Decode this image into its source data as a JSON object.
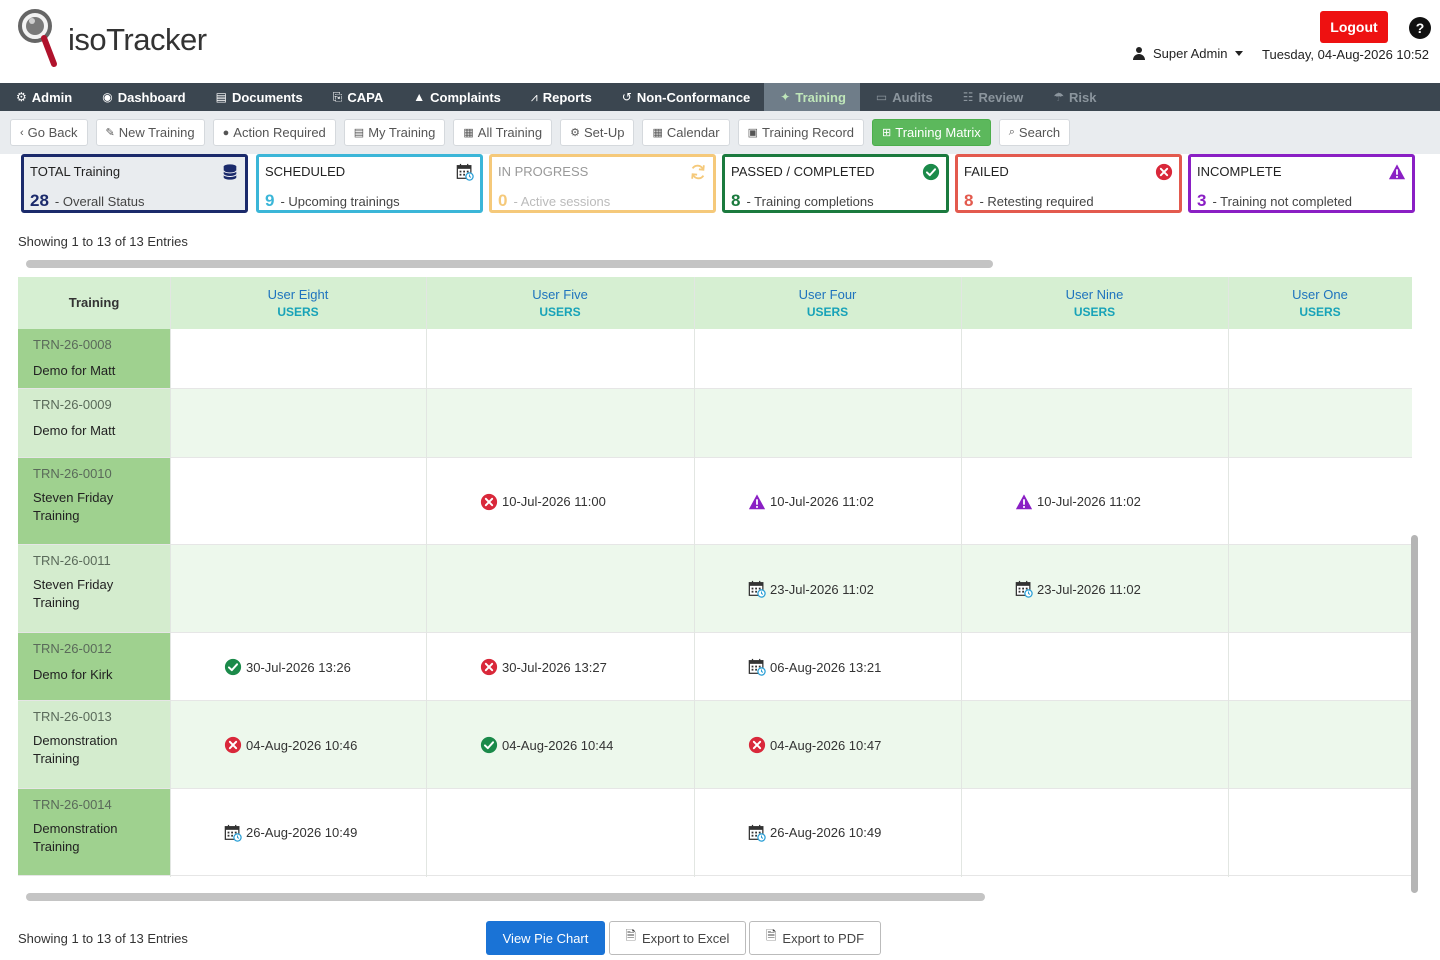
{
  "app": {
    "logo_text": "isoTracker",
    "logout_label": "Logout",
    "help_label": "?",
    "user_name": "Super Admin",
    "datetime": "Tuesday, 04-Aug-2026 10:52"
  },
  "mainnav": [
    {
      "label": "Admin",
      "icon": "gear-icon",
      "glyph": "⚙",
      "state": "normal"
    },
    {
      "label": "Dashboard",
      "icon": "dashboard-icon",
      "glyph": "◉",
      "state": "normal"
    },
    {
      "label": "Documents",
      "icon": "document-icon",
      "glyph": "▤",
      "state": "normal"
    },
    {
      "label": "CAPA",
      "icon": "capa-icon",
      "glyph": "⎘",
      "state": "normal"
    },
    {
      "label": "Complaints",
      "icon": "warning-icon",
      "glyph": "▲",
      "state": "normal"
    },
    {
      "label": "Reports",
      "icon": "chart-icon",
      "glyph": "⩘",
      "state": "normal"
    },
    {
      "label": "Non-Conformance",
      "icon": "history-icon",
      "glyph": "↺",
      "state": "normal"
    },
    {
      "label": "Training",
      "icon": "training-icon",
      "glyph": "✦",
      "state": "active"
    },
    {
      "label": "Audits",
      "icon": "audits-icon",
      "glyph": "▭",
      "state": "disabled"
    },
    {
      "label": "Review",
      "icon": "users-icon",
      "glyph": "☷",
      "state": "disabled"
    },
    {
      "label": "Risk",
      "icon": "risk-icon",
      "glyph": "☂",
      "state": "disabled"
    }
  ],
  "subnav": [
    {
      "label": "Go Back",
      "icon": "chevron-left-icon",
      "glyph": "‹",
      "active": false
    },
    {
      "label": "New Training",
      "icon": "new-training-icon",
      "glyph": "✎",
      "active": false
    },
    {
      "label": "Action Required",
      "icon": "action-required-icon",
      "glyph": "●",
      "active": false
    },
    {
      "label": "My Training",
      "icon": "my-training-icon",
      "glyph": "▤",
      "active": false
    },
    {
      "label": "All Training",
      "icon": "all-training-icon",
      "glyph": "▦",
      "active": false
    },
    {
      "label": "Set-Up",
      "icon": "setup-icon",
      "glyph": "⚙",
      "active": false
    },
    {
      "label": "Calendar",
      "icon": "calendar-icon",
      "glyph": "▦",
      "active": false
    },
    {
      "label": "Training Record",
      "icon": "record-icon",
      "glyph": "▣",
      "active": false
    },
    {
      "label": "Training Matrix",
      "icon": "matrix-icon",
      "glyph": "⊞",
      "active": true
    },
    {
      "label": "Search",
      "icon": "search-icon",
      "glyph": "⌕",
      "active": false
    }
  ],
  "cards": [
    {
      "title": "TOTAL Training",
      "count": "28",
      "sub": "- Overall Status",
      "icon": "database-icon",
      "border": "#1b2a6b",
      "bg": "#e9ecef",
      "numcolor": "#1b2a6b"
    },
    {
      "title": "SCHEDULED",
      "count": "9",
      "sub": "- Upcoming trainings",
      "icon": "calendar-icon",
      "border": "#3bb6d8",
      "bg": "#ffffff",
      "numcolor": "#3bb6d8"
    },
    {
      "title": "IN PROGRESS",
      "count": "0",
      "sub": "- Active sessions",
      "icon": "refresh-icon",
      "border": "#f5c97a",
      "bg": "#ffffff",
      "numcolor": "#f5c97a"
    },
    {
      "title": "PASSED / COMPLETED",
      "count": "8",
      "sub": "- Training completions",
      "icon": "check-circle-icon",
      "border": "#1b7a3e",
      "bg": "#ffffff",
      "numcolor": "#1b7a3e"
    },
    {
      "title": "FAILED",
      "count": "8",
      "sub": "- Retesting required",
      "icon": "x-circle-icon",
      "border": "#e35a4e",
      "bg": "#ffffff",
      "numcolor": "#e35a4e"
    },
    {
      "title": "INCOMPLETE",
      "count": "3",
      "sub": "- Training not completed",
      "icon": "warning-triangle-icon",
      "border": "#8a1fc4",
      "bg": "#ffffff",
      "numcolor": "#8a1fc4"
    }
  ],
  "showing_text": "Showing 1 to 13 of 13 Entries",
  "table": {
    "first_header": "Training",
    "columns": [
      {
        "name": "User Eight",
        "role": "USERS"
      },
      {
        "name": "User Five",
        "role": "USERS"
      },
      {
        "name": "User Four",
        "role": "USERS"
      },
      {
        "name": "User Nine",
        "role": "USERS"
      },
      {
        "name": "User One",
        "role": "USERS"
      }
    ],
    "rows": [
      {
        "code": "TRN-26-0008",
        "name": "Demo for Matt",
        "cells": [
          null,
          null,
          null,
          null,
          null
        ]
      },
      {
        "code": "TRN-26-0009",
        "name": "Demo for Matt",
        "cells": [
          null,
          null,
          null,
          null,
          null
        ]
      },
      {
        "code": "TRN-26-0010",
        "name": "Steven Friday Training",
        "cells": [
          null,
          {
            "status": "failed",
            "date": "10-Jul-2026 11:00"
          },
          {
            "status": "incomplete",
            "date": "10-Jul-2026 11:02"
          },
          {
            "status": "incomplete",
            "date": "10-Jul-2026 11:02"
          },
          null
        ]
      },
      {
        "code": "TRN-26-0011",
        "name": "Steven Friday Training",
        "cells": [
          null,
          null,
          {
            "status": "scheduled",
            "date": "23-Jul-2026 11:02"
          },
          {
            "status": "scheduled",
            "date": "23-Jul-2026 11:02"
          },
          null
        ]
      },
      {
        "code": "TRN-26-0012",
        "name": "Demo for Kirk",
        "cells": [
          {
            "status": "passed",
            "date": "30-Jul-2026 13:26"
          },
          {
            "status": "failed",
            "date": "30-Jul-2026 13:27"
          },
          {
            "status": "scheduled",
            "date": "06-Aug-2026 13:21"
          },
          null,
          null
        ]
      },
      {
        "code": "TRN-26-0013",
        "name": "Demonstration Training",
        "cells": [
          {
            "status": "failed",
            "date": "04-Aug-2026 10:46"
          },
          {
            "status": "passed",
            "date": "04-Aug-2026 10:44"
          },
          {
            "status": "failed",
            "date": "04-Aug-2026 10:47"
          },
          null,
          null
        ]
      },
      {
        "code": "TRN-26-0014",
        "name": "Demonstration Training",
        "cells": [
          {
            "status": "scheduled",
            "date": "26-Aug-2026 10:49"
          },
          null,
          {
            "status": "scheduled",
            "date": "26-Aug-2026 10:49"
          },
          null,
          null
        ]
      }
    ]
  },
  "footer": {
    "showing_text": "Showing 1 to 13 of 13 Entries",
    "pie_label": "View Pie Chart",
    "excel_label": "Export to Excel",
    "pdf_label": "Export to PDF"
  }
}
